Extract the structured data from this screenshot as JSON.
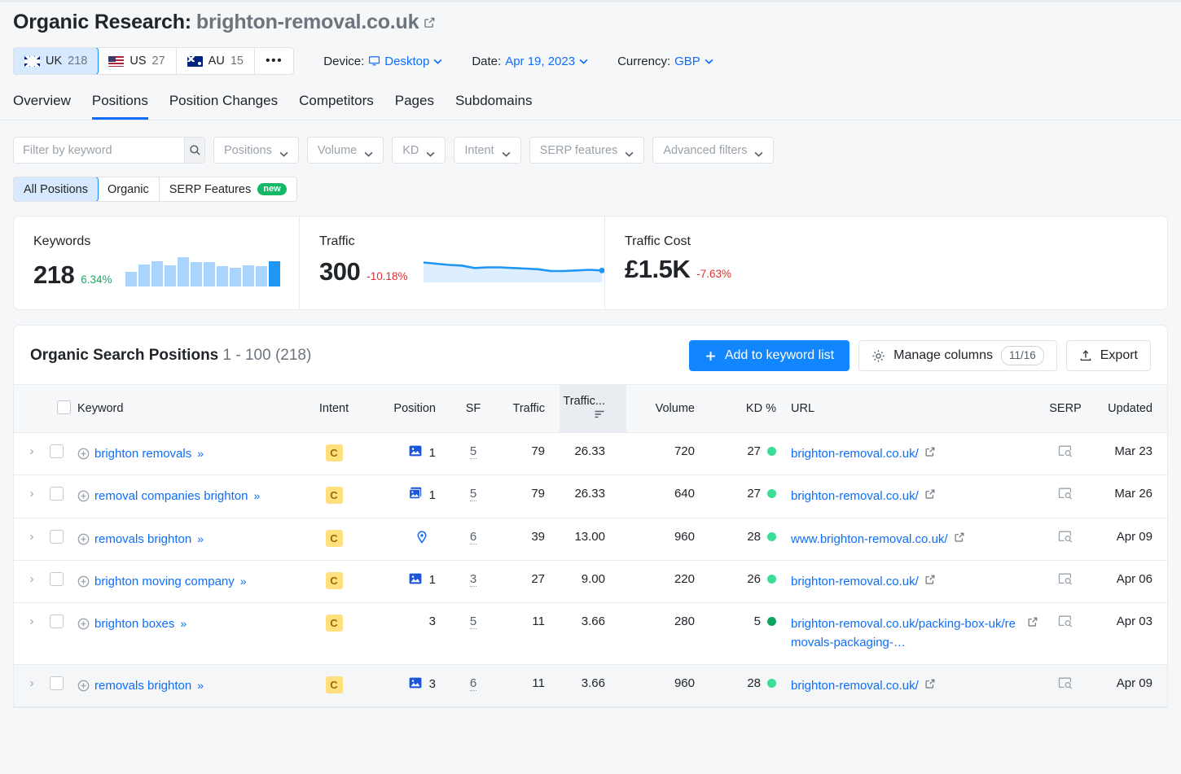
{
  "header": {
    "title_prefix": "Organic Research:",
    "domain": "brighton-removal.co.uk",
    "external_link_icon": "external-link-icon",
    "databases": [
      {
        "code": "UK",
        "count": "218",
        "flag": "uk-flag-icon",
        "active": true
      },
      {
        "code": "US",
        "count": "27",
        "flag": "us-flag-icon",
        "active": false
      },
      {
        "code": "AU",
        "count": "15",
        "flag": "au-flag-icon",
        "active": false
      }
    ],
    "more_label": "•••",
    "device": {
      "label": "Device:",
      "value": "Desktop",
      "icon": "desktop-monitor-icon"
    },
    "date": {
      "label": "Date:",
      "value": "Apr 19, 2023"
    },
    "currency": {
      "label": "Currency:",
      "value": "GBP"
    }
  },
  "nav": {
    "tabs": [
      {
        "label": "Overview",
        "active": false
      },
      {
        "label": "Positions",
        "active": true
      },
      {
        "label": "Position Changes",
        "active": false
      },
      {
        "label": "Competitors",
        "active": false
      },
      {
        "label": "Pages",
        "active": false
      },
      {
        "label": "Subdomains",
        "active": false
      }
    ]
  },
  "filters": {
    "search_placeholder": "Filter by keyword",
    "search_value": "",
    "search_icon": "search-icon",
    "dropdowns": [
      {
        "label": "Positions"
      },
      {
        "label": "Volume"
      },
      {
        "label": "KD"
      },
      {
        "label": "Intent"
      },
      {
        "label": "SERP features"
      },
      {
        "label": "Advanced filters"
      }
    ]
  },
  "segments": [
    {
      "label": "All Positions",
      "active": true,
      "badge": null
    },
    {
      "label": "Organic",
      "active": false,
      "badge": null
    },
    {
      "label": "SERP Features",
      "active": false,
      "badge": "new"
    }
  ],
  "summary": {
    "keywords": {
      "label": "Keywords",
      "value": "218",
      "delta": "6.34%",
      "delta_dir": "up"
    },
    "traffic": {
      "label": "Traffic",
      "value": "300",
      "delta": "-10.18%",
      "delta_dir": "down"
    },
    "traffic_cost": {
      "label": "Traffic Cost",
      "value": "£1.5K",
      "delta": "-7.63%",
      "delta_dir": "down"
    }
  },
  "chart_data": [
    {
      "type": "bar",
      "title": "Keywords",
      "categories": [
        "1",
        "2",
        "3",
        "4",
        "5",
        "6",
        "7",
        "8",
        "9",
        "10",
        "11",
        "12"
      ],
      "values": [
        18,
        27,
        31,
        26,
        36,
        30,
        30,
        25,
        23,
        26,
        25,
        31
      ],
      "xlabel": "",
      "ylabel": "",
      "ylim": [
        0,
        38
      ],
      "grid": false,
      "legend": false,
      "highlight_last": true,
      "colors": {
        "bar": "#a8d4ff",
        "last_bar": "#1e96f5"
      }
    },
    {
      "type": "area",
      "title": "Traffic",
      "x": [
        0,
        1,
        2,
        3,
        4,
        5,
        6,
        7,
        8,
        9,
        10,
        11,
        12,
        13,
        14
      ],
      "values": [
        30,
        28,
        26,
        25,
        21,
        22,
        22,
        21,
        20,
        19,
        16,
        16,
        17,
        18,
        17
      ],
      "xlabel": "",
      "ylabel": "",
      "ylim": [
        0,
        32
      ],
      "grid": false,
      "legend": false,
      "end_marker": true,
      "colors": {
        "line": "#1e96f5",
        "fill": "#dceeff"
      }
    }
  ],
  "table": {
    "title": "Organic Search Positions",
    "range": "1 - 100 (218)",
    "actions": {
      "add_to_list": "Add to keyword list",
      "plus_icon": "plus-icon",
      "manage_columns": "Manage columns",
      "gear_icon": "gear-icon",
      "columns_count": "11/16",
      "export": "Export",
      "export_icon": "upload-icon"
    },
    "columns": [
      {
        "key": "expand",
        "label": ""
      },
      {
        "key": "check",
        "label": ""
      },
      {
        "key": "keyword",
        "label": "Keyword"
      },
      {
        "key": "intent",
        "label": "Intent"
      },
      {
        "key": "position",
        "label": "Position"
      },
      {
        "key": "sf",
        "label": "SF"
      },
      {
        "key": "traffic",
        "label": "Traffic"
      },
      {
        "key": "traffic_pct",
        "label": "Traffic...",
        "sorted": true,
        "sort_icon": "sort-desc-icon"
      },
      {
        "key": "volume",
        "label": "Volume"
      },
      {
        "key": "kd",
        "label": "KD %"
      },
      {
        "key": "url",
        "label": "URL"
      },
      {
        "key": "serp",
        "label": "SERP"
      },
      {
        "key": "updated",
        "label": "Updated"
      }
    ],
    "rows": [
      {
        "keyword": "brighton removals",
        "intent": "C",
        "serp_feature_icon": "image-pack-icon",
        "position": "1",
        "sf": "5",
        "traffic": "79",
        "traffic_pct": "26.33",
        "volume": "720",
        "kd": "27",
        "kd_color": "#3ddc97",
        "url": "brighton-removal.co.uk/",
        "url_wrapped": false,
        "serp_icon": "serp-preview-icon",
        "updated": "Mar 23",
        "hovered": false
      },
      {
        "keyword": "removal companies brighton",
        "intent": "C",
        "serp_feature_icon": "image-pack-filled-icon",
        "position": "1",
        "sf": "5",
        "traffic": "79",
        "traffic_pct": "26.33",
        "volume": "640",
        "kd": "27",
        "kd_color": "#3ddc97",
        "url": "brighton-removal.co.uk/",
        "url_wrapped": false,
        "serp_icon": "serp-preview-icon",
        "updated": "Mar 26",
        "hovered": false
      },
      {
        "keyword": "removals brighton",
        "intent": "C",
        "serp_feature_icon": "local-pack-pin-icon",
        "position": "",
        "sf": "6",
        "traffic": "39",
        "traffic_pct": "13.00",
        "volume": "960",
        "kd": "28",
        "kd_color": "#3ddc97",
        "url": "www.brighton-removal.co.uk/",
        "url_wrapped": false,
        "serp_icon": "serp-preview-icon",
        "updated": "Apr 09",
        "hovered": false
      },
      {
        "keyword": "brighton moving company",
        "intent": "C",
        "serp_feature_icon": "image-pack-icon",
        "position": "1",
        "sf": "3",
        "traffic": "27",
        "traffic_pct": "9.00",
        "volume": "220",
        "kd": "26",
        "kd_color": "#3ddc97",
        "url": "brighton-removal.co.uk/",
        "url_wrapped": false,
        "serp_icon": "serp-preview-icon",
        "updated": "Apr 06",
        "hovered": false
      },
      {
        "keyword": "brighton boxes",
        "intent": "C",
        "serp_feature_icon": "",
        "position": "3",
        "sf": "5",
        "traffic": "11",
        "traffic_pct": "3.66",
        "volume": "280",
        "kd": "5",
        "kd_color": "#0fa55f",
        "url": "brighton-removal.co.uk/packing-box-uk/removals-packaging-…",
        "url_wrapped": true,
        "serp_icon": "serp-preview-icon",
        "updated": "Apr 03",
        "hovered": false
      },
      {
        "keyword": "removals brighton",
        "intent": "C",
        "serp_feature_icon": "image-pack-icon",
        "position": "3",
        "sf": "6",
        "traffic": "11",
        "traffic_pct": "3.66",
        "volume": "960",
        "kd": "28",
        "kd_color": "#3ddc97",
        "url": "brighton-removal.co.uk/",
        "url_wrapped": false,
        "serp_icon": "serp-preview-icon",
        "updated": "Apr 09",
        "hovered": true
      }
    ]
  },
  "colors": {
    "accent": "#0d6efd",
    "primary_button": "#1286ff",
    "positive": "#23a566",
    "negative": "#e02f2f",
    "badge_new": "#14b866",
    "intent_badge_bg": "#ffdf7e"
  }
}
